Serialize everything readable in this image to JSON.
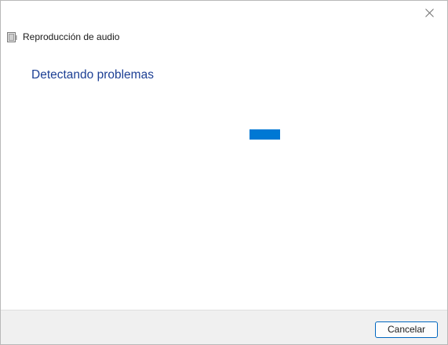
{
  "window": {
    "title": "Reproducción de audio",
    "close_label": "✕"
  },
  "main": {
    "heading": "Detectando problemas",
    "progress": {
      "state": "indeterminate",
      "color": "#0078d4"
    }
  },
  "footer": {
    "cancel_label": "Cancelar"
  },
  "colors": {
    "heading": "#1c3f94",
    "accent": "#0078d4",
    "footer_bg": "#f0f0f0"
  }
}
